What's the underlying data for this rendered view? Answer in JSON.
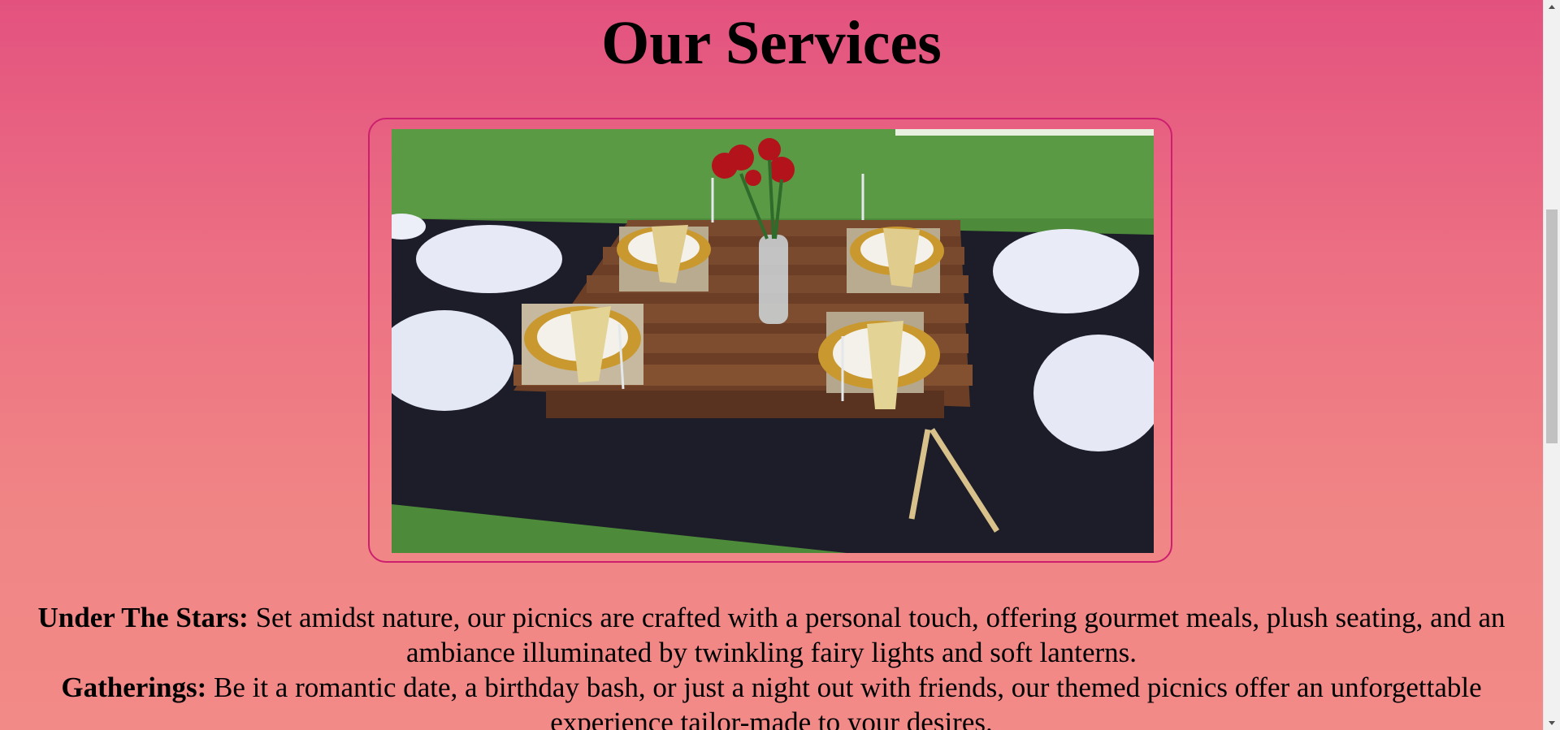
{
  "section": {
    "title": "Our Services"
  },
  "image": {
    "alt": "Picnic table setup on pallets with roses, plates and cushions"
  },
  "services": [
    {
      "name": "Under The Stars:",
      "text": " Set amidst nature, our picnics are crafted with a personal touch, offering gourmet meals, plush seating, and an ambiance illuminated by twinkling fairy lights and soft lanterns."
    },
    {
      "name": "Gatherings:",
      "text": " Be it a romantic date, a birthday bash, or just a night out with friends, our themed picnics offer an unforgettable experience tailor-made to your desires."
    }
  ],
  "colors": {
    "background_top": "#e3527f",
    "background_bottom": "#f28a87",
    "frame_border": "#cc1f6e"
  }
}
